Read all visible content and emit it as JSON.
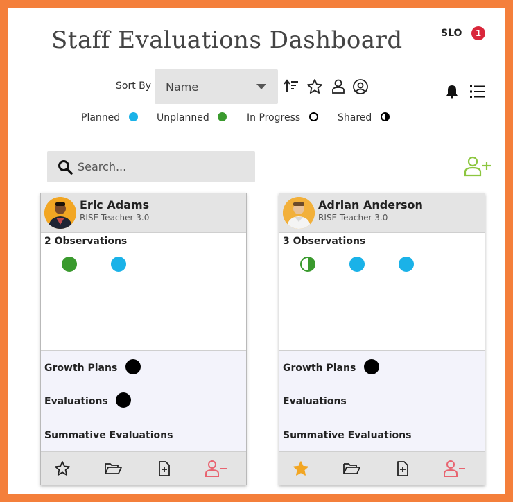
{
  "page": {
    "title": "Staff Evaluations Dashboard"
  },
  "header": {
    "slo_label": "SLO",
    "slo_count": "1"
  },
  "sort": {
    "label": "Sort By",
    "selected": "Name"
  },
  "toolbar_icons": [
    "sort-order-icon",
    "star-outline-icon",
    "person-outline-icon",
    "person-circle-icon",
    "bell-icon",
    "list-icon"
  ],
  "legend": [
    {
      "label": "Planned",
      "marker": "solid",
      "color": "#1ab2e8"
    },
    {
      "label": "Unplanned",
      "marker": "solid",
      "color": "#3a9a2e"
    },
    {
      "label": "In Progress",
      "marker": "ring",
      "color": "#000000"
    },
    {
      "label": "Shared",
      "marker": "half",
      "color": "#000000"
    }
  ],
  "search": {
    "placeholder": "Search..."
  },
  "colors": {
    "frame": "#f47f3b",
    "add_user": "#8cc63f",
    "remove_user": "#e86470",
    "favorite": "#f2a623",
    "planned": "#1ab2e8",
    "unplanned": "#3a9a2e"
  },
  "cards": [
    {
      "name": "Eric Adams",
      "role": "RISE Teacher 3.0",
      "observations_label": "2 Observations",
      "observations": [
        "unplanned",
        "planned"
      ],
      "growth_plans_label": "Growth Plans",
      "evaluations_label": "Evaluations",
      "summative_label": "Summative Evaluations",
      "favorite": false
    },
    {
      "name": "Adrian Anderson",
      "role": "RISE Teacher 3.0",
      "observations_label": "3 Observations",
      "observations": [
        "unplanned-shared",
        "planned",
        "planned"
      ],
      "growth_plans_label": "Growth Plans",
      "evaluations_label": "Evaluations",
      "summative_label": "Summative Evaluations",
      "favorite": true
    }
  ]
}
